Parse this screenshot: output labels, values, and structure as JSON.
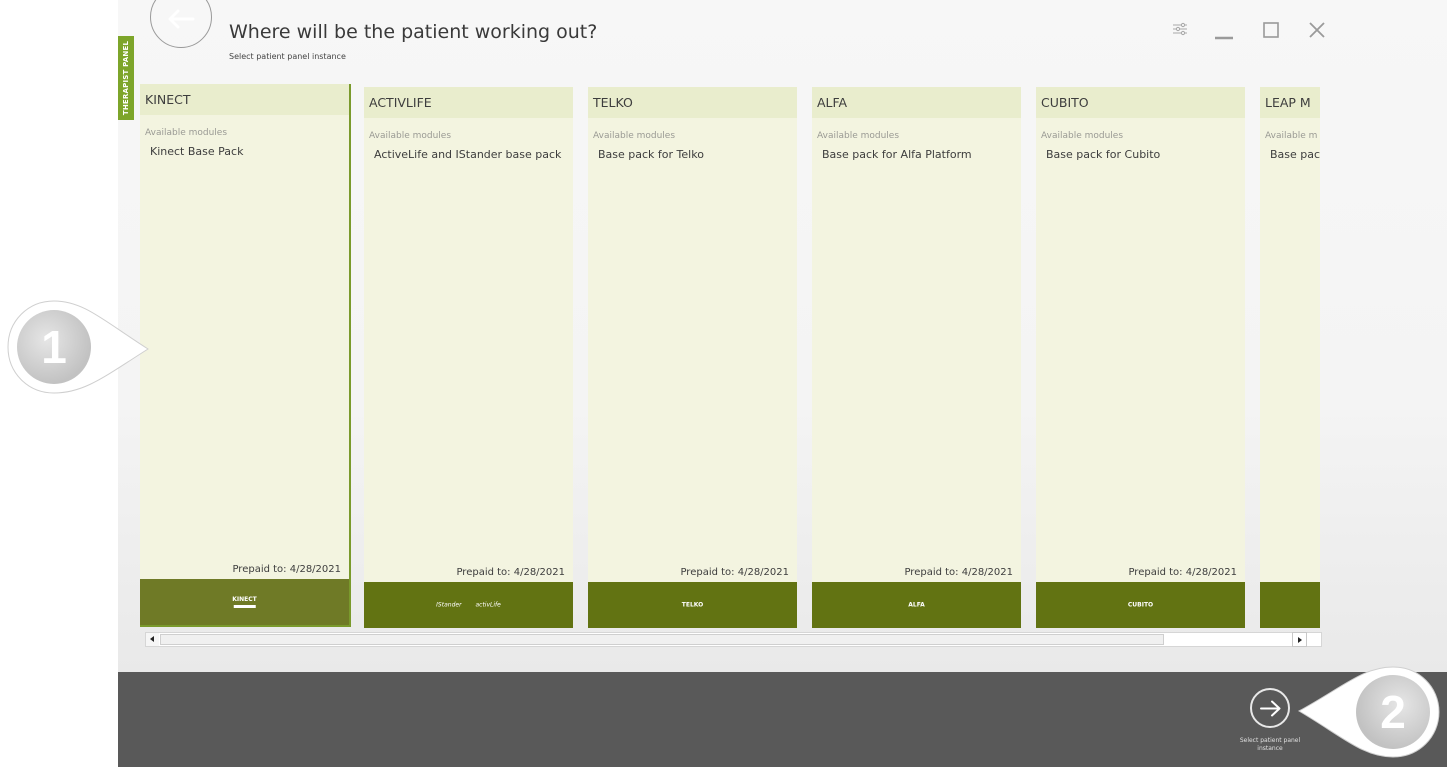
{
  "app": {
    "therapist_tab": "THERAPIST PANEL",
    "title": "Where will be the patient working out?",
    "subtitle": "Select patient panel instance"
  },
  "window_controls": {
    "settings_icon": "settings-sliders-icon",
    "minimize_icon": "minimize-icon",
    "maximize_icon": "maximize-icon",
    "close_icon": "close-icon"
  },
  "cards": [
    {
      "title": "KINECT",
      "modules_label": "Available modules",
      "module": "Kinect Base Pack",
      "prepaid": "Prepaid to: 4/28/2021",
      "logo_main": "KINECT",
      "logo_alt": "",
      "selected": true
    },
    {
      "title": "ACTIVLIFE",
      "modules_label": "Available modules",
      "module": "ActiveLife and IStander base pack",
      "prepaid": "Prepaid to: 4/28/2021",
      "logo_main": "IStander",
      "logo_alt": "activLife",
      "selected": false
    },
    {
      "title": "TELKO",
      "modules_label": "Available modules",
      "module": "Base pack for Telko",
      "prepaid": "Prepaid to: 4/28/2021",
      "logo_main": "TELKO",
      "logo_alt": "",
      "selected": false
    },
    {
      "title": "ALFA",
      "modules_label": "Available modules",
      "module": "Base pack for Alfa Platform",
      "prepaid": "Prepaid to: 4/28/2021",
      "logo_main": "ALFA",
      "logo_alt": "",
      "selected": false
    },
    {
      "title": "CUBITO",
      "modules_label": "Available modules",
      "module": "Base pack for Cubito",
      "prepaid": "Prepaid to: 4/28/2021",
      "logo_main": "CUBITO",
      "logo_alt": "",
      "selected": false
    },
    {
      "title": "LEAP M",
      "modules_label": "Available m",
      "module": "Base pac",
      "prepaid": "",
      "logo_main": "",
      "logo_alt": "",
      "selected": false
    }
  ],
  "footer": {
    "next_label": "Select patient panel instance"
  },
  "callouts": [
    {
      "number": "1"
    },
    {
      "number": "2"
    }
  ],
  "colors": {
    "accent_green": "#7da52a",
    "card_bg": "#f3f4e0",
    "card_head": "#e9edcd",
    "brand_strip": "#627312",
    "bottom_bar": "#595959"
  }
}
